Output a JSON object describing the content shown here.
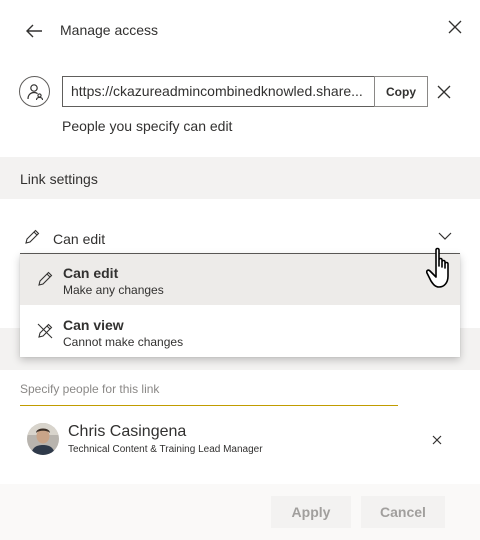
{
  "header": {
    "title": "Manage access",
    "back_icon": "back-arrow-icon",
    "close_icon": "close-icon"
  },
  "link": {
    "url": "https://ckazureadmincombinedknowled.share...",
    "copy_label": "Copy",
    "note": "People you specify can edit"
  },
  "link_settings": {
    "label": "Link settings",
    "selected_permission": "Can edit"
  },
  "menu": {
    "items": [
      {
        "title": "Can edit",
        "subtitle": "Make any changes",
        "icon": "pencil-icon",
        "selected": true
      },
      {
        "title": "Can view",
        "subtitle": "Cannot make changes",
        "icon": "no-edit-pencil-icon",
        "selected": false
      }
    ]
  },
  "people": {
    "placeholder": "Specify people for this link",
    "list": [
      {
        "name": "Chris Casingena",
        "title": "Technical Content & Training Lead Manager"
      }
    ]
  },
  "footer": {
    "apply_label": "Apply",
    "cancel_label": "Cancel"
  },
  "colors": {
    "text": "#323130",
    "band": "#f3f2f1",
    "selected": "#edebe9",
    "disabled_text": "#a19f9d",
    "accent_underline": "#c19c00"
  }
}
